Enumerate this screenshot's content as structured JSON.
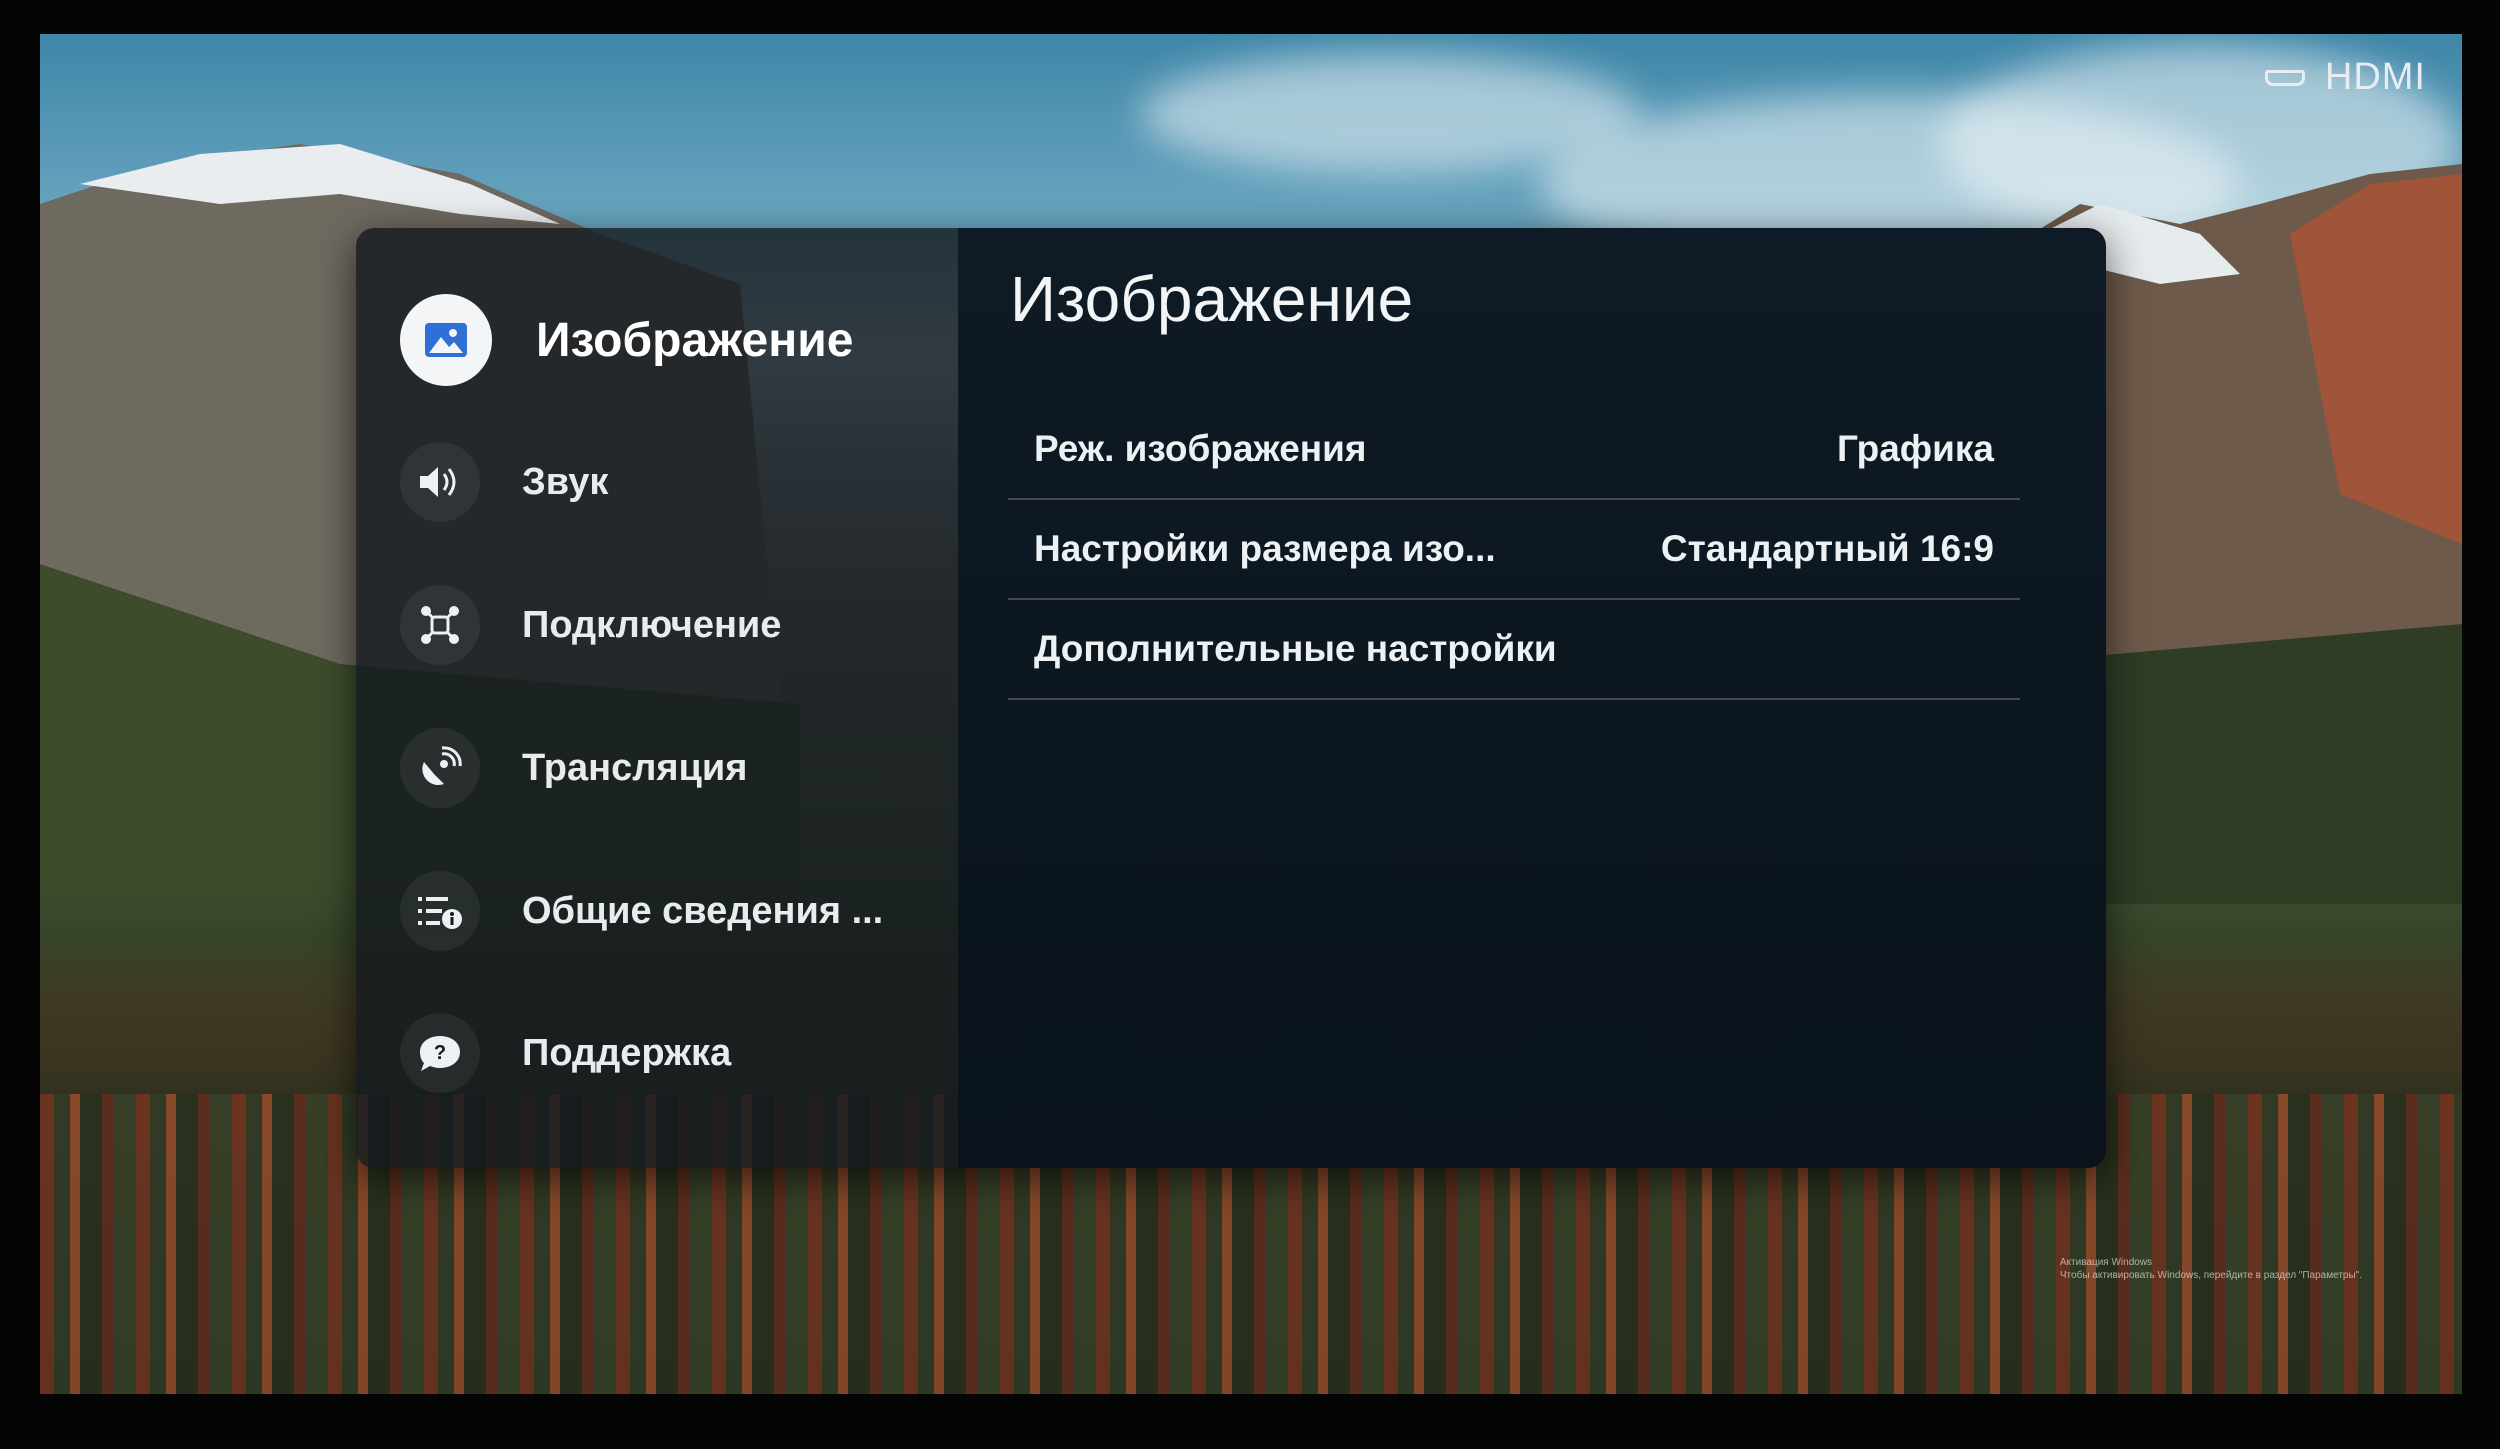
{
  "source_label": "HDMI",
  "sidebar": {
    "items": [
      {
        "label": "Изображение",
        "icon": "picture-icon",
        "active": true
      },
      {
        "label": "Звук",
        "icon": "speaker-icon"
      },
      {
        "label": "Подключение",
        "icon": "connection-icon"
      },
      {
        "label": "Трансляция",
        "icon": "broadcast-icon"
      },
      {
        "label": "Общие сведения ...",
        "icon": "general-info-icon"
      },
      {
        "label": "Поддержка",
        "icon": "support-icon"
      }
    ]
  },
  "content": {
    "title": "Изображение",
    "rows": [
      {
        "label": "Реж. изображения",
        "value": "Графика"
      },
      {
        "label": "Настройки размера изо...",
        "value": "Стандартный 16:9"
      },
      {
        "label": "Дополнительные настройки",
        "value": ""
      }
    ]
  },
  "watermark": {
    "line1": "Активация Windows",
    "line2": "Чтобы активировать Windows, перейдите в раздел \"Параметры\"."
  },
  "colors": {
    "panel_sidebar": "#141a1e",
    "panel_content": "#0e1a25",
    "active_icon_bg": "#f3f5f7",
    "active_icon_fg": "#2f6fd6",
    "text": "#eef1f3"
  }
}
